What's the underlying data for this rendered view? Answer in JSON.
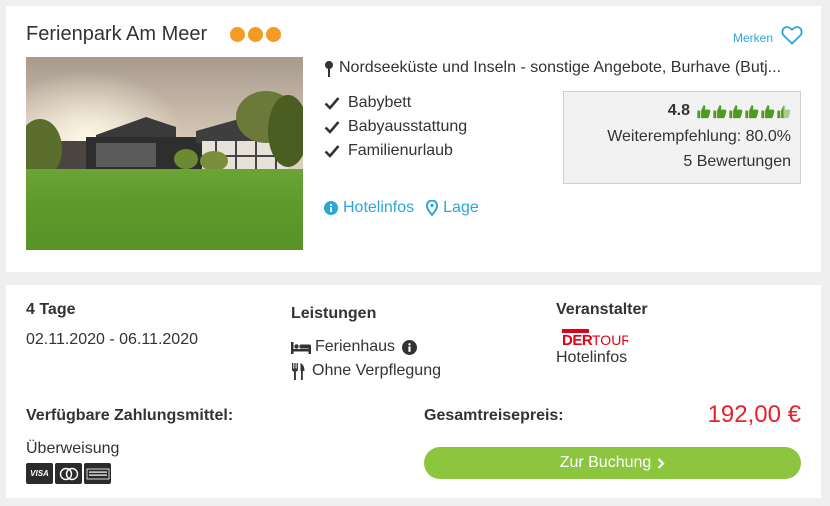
{
  "hotel": {
    "name": "Ferienpark Am Meer",
    "category_stars": 3,
    "save_label": "Merken",
    "location": "Nordseeküste und Inseln - sonstige Angebote, Burhave (Butj...",
    "amenities": [
      "Babybett",
      "Babyausstattung",
      "Familienurlaub"
    ],
    "links": {
      "info": "Hotelinfos",
      "map": "Lage"
    }
  },
  "rating": {
    "score": "4.8",
    "thumbs_filled": 5.5,
    "thumbs_total": 6,
    "recommendation": "Weiterempfehlung: 80.0%",
    "reviews": "5 Bewertungen"
  },
  "offer": {
    "duration": "4 Tage",
    "dates": "02.11.2020 - 06.11.2020",
    "services_heading": "Leistungen",
    "accommodation": "Ferienhaus",
    "board": "Ohne Verpflegung",
    "operator_heading": "Veranstalter",
    "operator_logo_text": "DERTOUR",
    "operator_link": "Hotelinfos",
    "payment_heading": "Verfügbare Zahlungsmittel:",
    "payment_method": "Überweisung",
    "payment_cards": [
      "visa",
      "mastercard",
      "american-express"
    ],
    "total_heading": "Gesamtreisepreis:",
    "price": "192,00 €",
    "book_label": "Zur Buchung"
  },
  "colors": {
    "accent": "#2aa7d9",
    "star": "#f59a23",
    "thumb": "#4f9a1e",
    "price": "#e8202a",
    "button": "#8cc63f"
  }
}
